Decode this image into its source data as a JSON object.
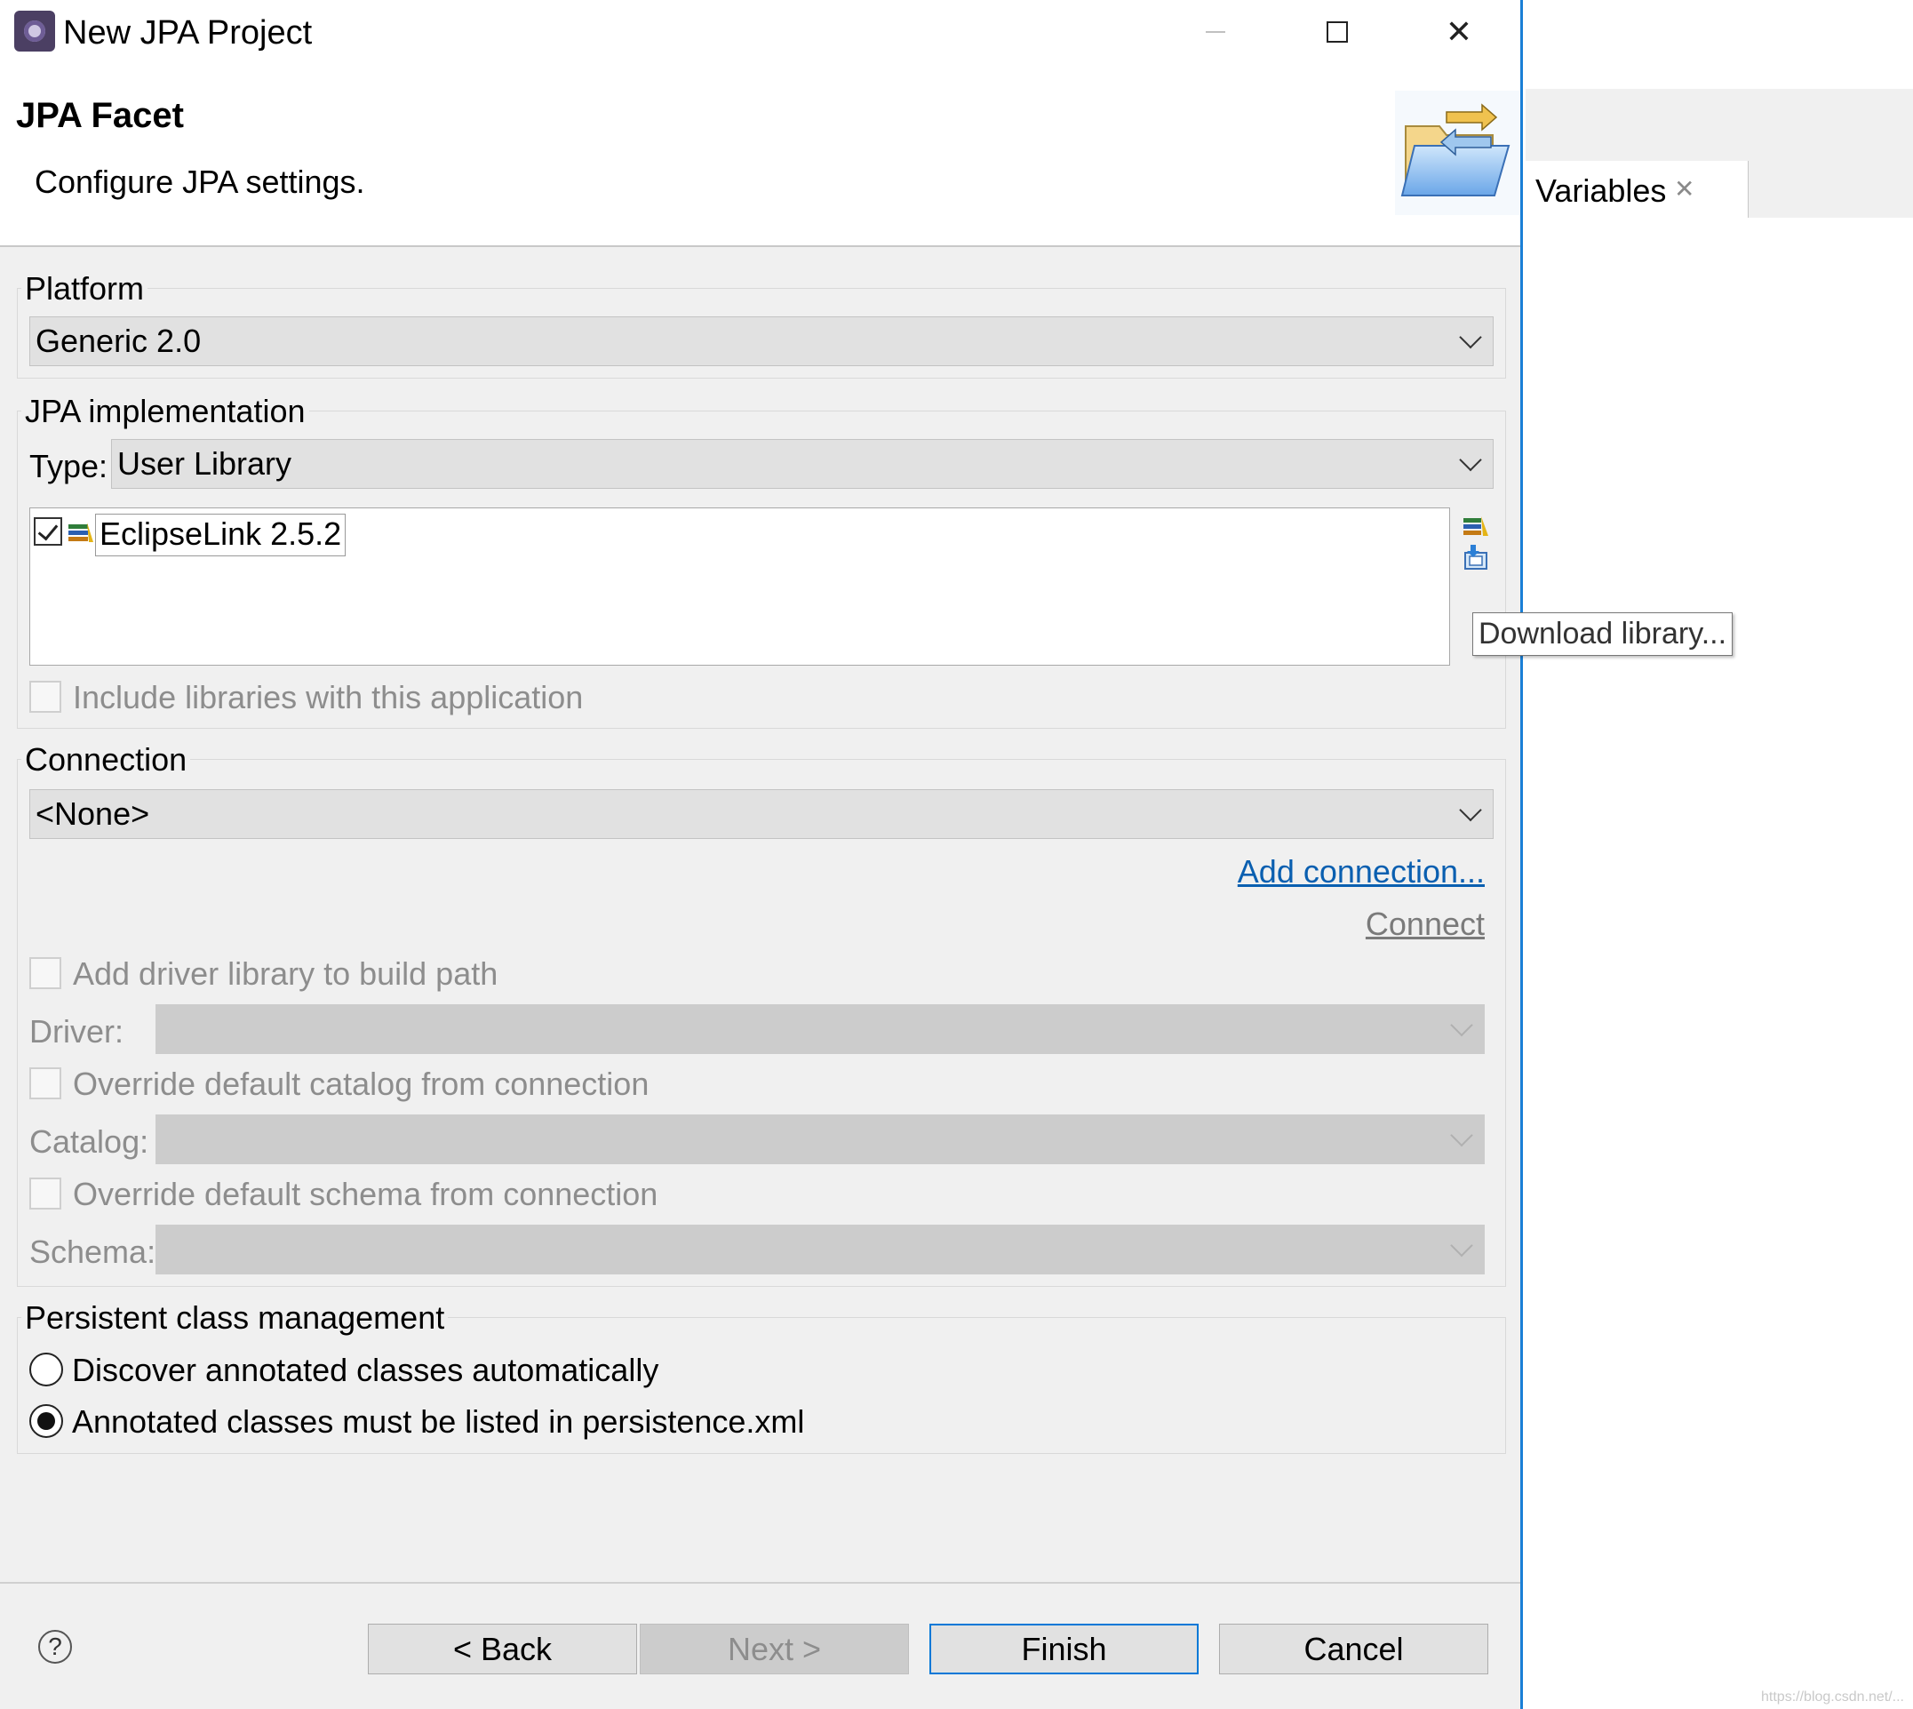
{
  "window": {
    "title": "New JPA Project"
  },
  "header": {
    "title": "JPA Facet",
    "description": "Configure JPA settings."
  },
  "platform": {
    "label": "Platform",
    "value": "Generic 2.0"
  },
  "jpa_impl": {
    "label": "JPA implementation",
    "type_label": "Type:",
    "type_value": "User Library",
    "libraries": [
      {
        "label": "EclipseLink 2.5.2",
        "checked": true
      }
    ],
    "include_label": "Include libraries with this application",
    "tooltip": "Download library..."
  },
  "connection": {
    "label": "Connection",
    "value": "<None>",
    "add_link": "Add connection...",
    "connect_link": "Connect",
    "add_driver_label": "Add driver library to build path",
    "driver_label": "Driver:",
    "override_catalog_label": "Override default catalog from connection",
    "catalog_label": "Catalog:",
    "override_schema_label": "Override default schema from connection",
    "schema_label": "Schema:"
  },
  "persistent": {
    "label": "Persistent class management",
    "options": [
      {
        "label": "Discover annotated classes automatically",
        "selected": false
      },
      {
        "label": "Annotated classes must be listed in persistence.xml",
        "selected": true
      }
    ]
  },
  "buttons": {
    "help": "?",
    "back": "< Back",
    "next": "Next >",
    "finish": "Finish",
    "cancel": "Cancel"
  },
  "background": {
    "tab_label": "Variables",
    "tab_close": "✕",
    "watermark": "https://blog.csdn.net/..."
  },
  "colors": {
    "accent": "#0078d7",
    "link": "#0a5fb0",
    "dialog_bg": "#f0f0f0"
  }
}
